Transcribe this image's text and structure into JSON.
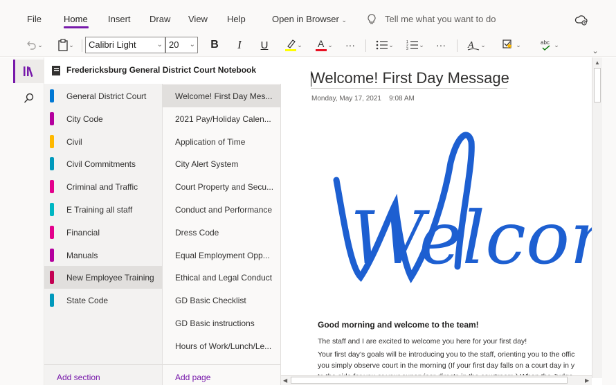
{
  "menu": {
    "file": "File",
    "home": "Home",
    "insert": "Insert",
    "draw": "Draw",
    "view": "View",
    "help": "Help",
    "open_in_browser": "Open in Browser",
    "tell_me": "Tell me what you want to do"
  },
  "toolbar": {
    "font_name": "Calibri Light",
    "font_size": "20",
    "bold": "B",
    "italic": "I",
    "underline": "U",
    "more": "···",
    "highlight_letter": "A",
    "spell_text": "abc"
  },
  "colors": {
    "accent": "#7719aa",
    "highlight": "#ffff00",
    "font_color": "#e81123",
    "welcome_blue": "#1d5fd1"
  },
  "notebook": {
    "title": "Fredericksburg General District Court Notebook"
  },
  "sections": [
    {
      "label": "General District Court",
      "color": "#0078d4",
      "selected": false
    },
    {
      "label": "City Code",
      "color": "#b4009e",
      "selected": false
    },
    {
      "label": "Civil",
      "color": "#ffb900",
      "selected": false
    },
    {
      "label": "Civil Commitments",
      "color": "#0099bc",
      "selected": false
    },
    {
      "label": "Criminal and Traffic",
      "color": "#e3008c",
      "selected": false
    },
    {
      "label": "E Training all staff",
      "color": "#00b7c3",
      "selected": false
    },
    {
      "label": "Financial",
      "color": "#e3008c",
      "selected": false
    },
    {
      "label": "Manuals",
      "color": "#b4009e",
      "selected": false
    },
    {
      "label": "New Employee Training",
      "color": "#c30052",
      "selected": true
    },
    {
      "label": "State Code",
      "color": "#0099bc",
      "selected": false
    }
  ],
  "pages": [
    {
      "label": "Welcome! First Day Mes...",
      "selected": true
    },
    {
      "label": "2021 Pay/Holiday Calen...",
      "selected": false
    },
    {
      "label": "Application of Time",
      "selected": false
    },
    {
      "label": "City Alert System",
      "selected": false
    },
    {
      "label": "Court Property and Secu...",
      "selected": false
    },
    {
      "label": "Conduct and Performance",
      "selected": false
    },
    {
      "label": "Dress Code",
      "selected": false
    },
    {
      "label": "Equal Employment Opp...",
      "selected": false
    },
    {
      "label": "Ethical and Legal Conduct",
      "selected": false
    },
    {
      "label": "GD Basic Checklist",
      "selected": false
    },
    {
      "label": "GD Basic instructions",
      "selected": false
    },
    {
      "label": "Hours of Work/Lunch/Le...",
      "selected": false
    }
  ],
  "footer": {
    "add_section": "Add section",
    "add_page": "Add page"
  },
  "page": {
    "title": "Welcome! First Day Message",
    "date": "Monday, May 17, 2021",
    "time": "9:08 AM",
    "art_text": "Welcome",
    "greeting": "Good morning and welcome to the team!",
    "para1": "The staff and I are excited to welcome you here for your first day!",
    "para2_line1": "Your first day’s goals will be introducing you to the staff, orienting you to the offic",
    "para2_line2": "you simply observe court in the morning (If your first day falls on a court day in y",
    "para2_line3": "to the side for you or your supervisor directs in the courtroom.) When the Judge"
  }
}
